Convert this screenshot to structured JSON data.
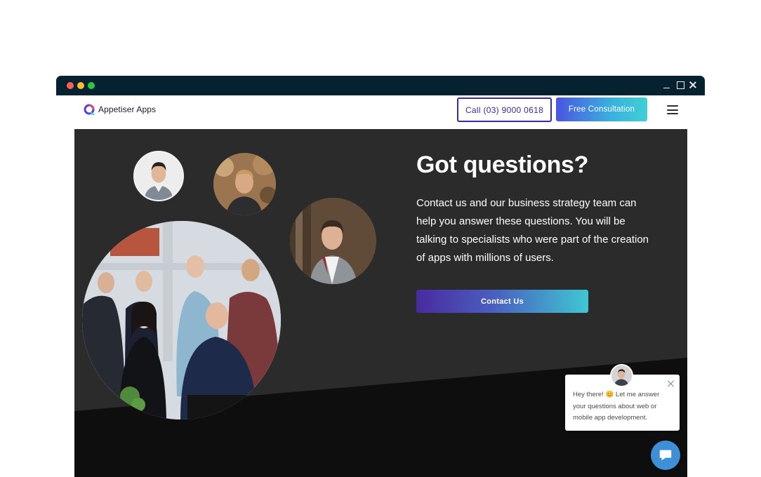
{
  "browser": {
    "window_controls": [
      "minimize-icon",
      "maximize-icon",
      "close-icon"
    ]
  },
  "header": {
    "brand": "Appetiser Apps",
    "call_label": "Call (03) 9000 0618",
    "consult_label": "Free Consultation",
    "menu_icon": "hamburger-menu-icon"
  },
  "hero": {
    "title": "Got questions?",
    "body": "Contact us and our business strategy team can help you answer these questions. You will be talking to specialists who were part of the creation of apps with millions of users.",
    "cta_label": "Contact Us"
  },
  "chat": {
    "message": "Hey there! 😊 Let me answer your questions about web or mobile app development.",
    "launcher_icon": "chat-bubble-icon",
    "close_icon": "close-icon"
  },
  "colors": {
    "chrome_bar": "#062230",
    "hero_bg": "#2b2b2b",
    "hero_band": "#0e0e0e",
    "brand_purple": "#3a2aa3",
    "accent_teal": "#3fd0d6",
    "chat_blue": "#3f8fd6"
  }
}
